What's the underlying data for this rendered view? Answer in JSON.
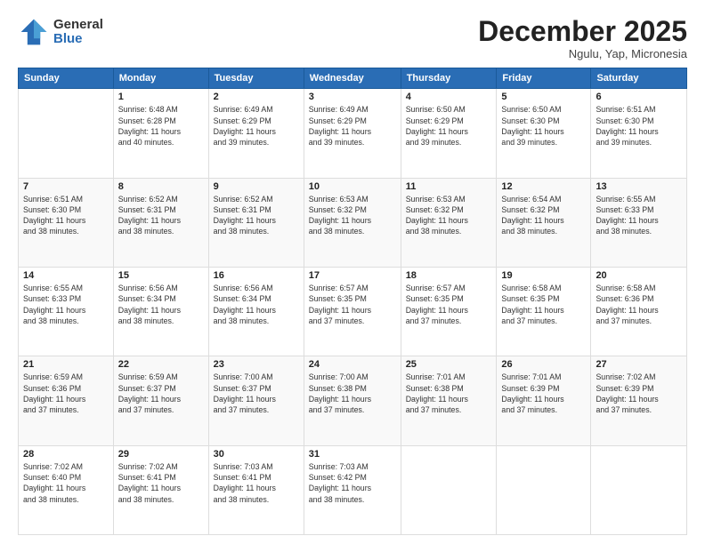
{
  "header": {
    "logo_general": "General",
    "logo_blue": "Blue",
    "month_title": "December 2025",
    "location": "Ngulu, Yap, Micronesia"
  },
  "days_of_week": [
    "Sunday",
    "Monday",
    "Tuesday",
    "Wednesday",
    "Thursday",
    "Friday",
    "Saturday"
  ],
  "weeks": [
    [
      {
        "day": "",
        "info": ""
      },
      {
        "day": "1",
        "info": "Sunrise: 6:48 AM\nSunset: 6:28 PM\nDaylight: 11 hours\nand 40 minutes."
      },
      {
        "day": "2",
        "info": "Sunrise: 6:49 AM\nSunset: 6:29 PM\nDaylight: 11 hours\nand 39 minutes."
      },
      {
        "day": "3",
        "info": "Sunrise: 6:49 AM\nSunset: 6:29 PM\nDaylight: 11 hours\nand 39 minutes."
      },
      {
        "day": "4",
        "info": "Sunrise: 6:50 AM\nSunset: 6:29 PM\nDaylight: 11 hours\nand 39 minutes."
      },
      {
        "day": "5",
        "info": "Sunrise: 6:50 AM\nSunset: 6:30 PM\nDaylight: 11 hours\nand 39 minutes."
      },
      {
        "day": "6",
        "info": "Sunrise: 6:51 AM\nSunset: 6:30 PM\nDaylight: 11 hours\nand 39 minutes."
      }
    ],
    [
      {
        "day": "7",
        "info": "Sunrise: 6:51 AM\nSunset: 6:30 PM\nDaylight: 11 hours\nand 38 minutes."
      },
      {
        "day": "8",
        "info": "Sunrise: 6:52 AM\nSunset: 6:31 PM\nDaylight: 11 hours\nand 38 minutes."
      },
      {
        "day": "9",
        "info": "Sunrise: 6:52 AM\nSunset: 6:31 PM\nDaylight: 11 hours\nand 38 minutes."
      },
      {
        "day": "10",
        "info": "Sunrise: 6:53 AM\nSunset: 6:32 PM\nDaylight: 11 hours\nand 38 minutes."
      },
      {
        "day": "11",
        "info": "Sunrise: 6:53 AM\nSunset: 6:32 PM\nDaylight: 11 hours\nand 38 minutes."
      },
      {
        "day": "12",
        "info": "Sunrise: 6:54 AM\nSunset: 6:32 PM\nDaylight: 11 hours\nand 38 minutes."
      },
      {
        "day": "13",
        "info": "Sunrise: 6:55 AM\nSunset: 6:33 PM\nDaylight: 11 hours\nand 38 minutes."
      }
    ],
    [
      {
        "day": "14",
        "info": "Sunrise: 6:55 AM\nSunset: 6:33 PM\nDaylight: 11 hours\nand 38 minutes."
      },
      {
        "day": "15",
        "info": "Sunrise: 6:56 AM\nSunset: 6:34 PM\nDaylight: 11 hours\nand 38 minutes."
      },
      {
        "day": "16",
        "info": "Sunrise: 6:56 AM\nSunset: 6:34 PM\nDaylight: 11 hours\nand 38 minutes."
      },
      {
        "day": "17",
        "info": "Sunrise: 6:57 AM\nSunset: 6:35 PM\nDaylight: 11 hours\nand 37 minutes."
      },
      {
        "day": "18",
        "info": "Sunrise: 6:57 AM\nSunset: 6:35 PM\nDaylight: 11 hours\nand 37 minutes."
      },
      {
        "day": "19",
        "info": "Sunrise: 6:58 AM\nSunset: 6:35 PM\nDaylight: 11 hours\nand 37 minutes."
      },
      {
        "day": "20",
        "info": "Sunrise: 6:58 AM\nSunset: 6:36 PM\nDaylight: 11 hours\nand 37 minutes."
      }
    ],
    [
      {
        "day": "21",
        "info": "Sunrise: 6:59 AM\nSunset: 6:36 PM\nDaylight: 11 hours\nand 37 minutes."
      },
      {
        "day": "22",
        "info": "Sunrise: 6:59 AM\nSunset: 6:37 PM\nDaylight: 11 hours\nand 37 minutes."
      },
      {
        "day": "23",
        "info": "Sunrise: 7:00 AM\nSunset: 6:37 PM\nDaylight: 11 hours\nand 37 minutes."
      },
      {
        "day": "24",
        "info": "Sunrise: 7:00 AM\nSunset: 6:38 PM\nDaylight: 11 hours\nand 37 minutes."
      },
      {
        "day": "25",
        "info": "Sunrise: 7:01 AM\nSunset: 6:38 PM\nDaylight: 11 hours\nand 37 minutes."
      },
      {
        "day": "26",
        "info": "Sunrise: 7:01 AM\nSunset: 6:39 PM\nDaylight: 11 hours\nand 37 minutes."
      },
      {
        "day": "27",
        "info": "Sunrise: 7:02 AM\nSunset: 6:39 PM\nDaylight: 11 hours\nand 37 minutes."
      }
    ],
    [
      {
        "day": "28",
        "info": "Sunrise: 7:02 AM\nSunset: 6:40 PM\nDaylight: 11 hours\nand 38 minutes."
      },
      {
        "day": "29",
        "info": "Sunrise: 7:02 AM\nSunset: 6:41 PM\nDaylight: 11 hours\nand 38 minutes."
      },
      {
        "day": "30",
        "info": "Sunrise: 7:03 AM\nSunset: 6:41 PM\nDaylight: 11 hours\nand 38 minutes."
      },
      {
        "day": "31",
        "info": "Sunrise: 7:03 AM\nSunset: 6:42 PM\nDaylight: 11 hours\nand 38 minutes."
      },
      {
        "day": "",
        "info": ""
      },
      {
        "day": "",
        "info": ""
      },
      {
        "day": "",
        "info": ""
      }
    ]
  ]
}
